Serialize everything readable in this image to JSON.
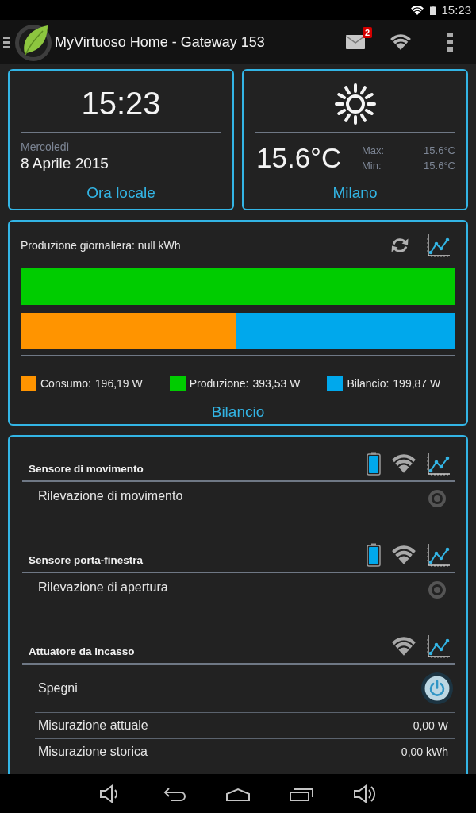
{
  "status_bar": {
    "time": "15:23"
  },
  "action_bar": {
    "title": "MyVirtuoso Home - Gateway 153",
    "mail_badge": "2"
  },
  "clock_card": {
    "time": "15:23",
    "weekday": "Mercoledì",
    "date": "8 Aprile 2015",
    "caption": "Ora locale"
  },
  "weather_card": {
    "temperature": "15.6°C",
    "max_label": "Max:",
    "max": "15.6°C",
    "min_label": "Min:",
    "min": "15.6°C",
    "caption": "Milano"
  },
  "energy_card": {
    "daily_production": "Produzione giornaliera: null kWh",
    "bars": [
      {
        "level": 1,
        "color": "#00cc00"
      },
      {
        "level": 0.496,
        "color": "#ff9400"
      }
    ],
    "legend": [
      {
        "label": "Consumo:",
        "value": "196,19 W",
        "color": "#ff9400"
      },
      {
        "label": "Produzione:",
        "value": "393,53 W",
        "color": "#00cc00"
      },
      {
        "label": "Bilancio:",
        "value": "199,87 W",
        "color": "#00a8ec"
      }
    ],
    "caption": "Bilancio"
  },
  "devices": [
    {
      "title": "Sensore di movimento",
      "battery": true,
      "rows": [
        {
          "kind": "status",
          "label": "Rilevazione di movimento",
          "active": false
        }
      ]
    },
    {
      "title": "Sensore porta-finestra",
      "battery": true,
      "rows": [
        {
          "kind": "status",
          "label": "Rilevazione di apertura",
          "active": false
        }
      ]
    },
    {
      "title": "Attuatore da incasso",
      "battery": false,
      "rows": [
        {
          "kind": "switch",
          "label": "Spegni",
          "on": true
        },
        {
          "kind": "measurement",
          "label": "Misurazione attuale",
          "value": "0,00 W"
        },
        {
          "kind": "measurement",
          "label": "Misurazione storica",
          "value": "0,00 kWh"
        }
      ]
    }
  ]
}
